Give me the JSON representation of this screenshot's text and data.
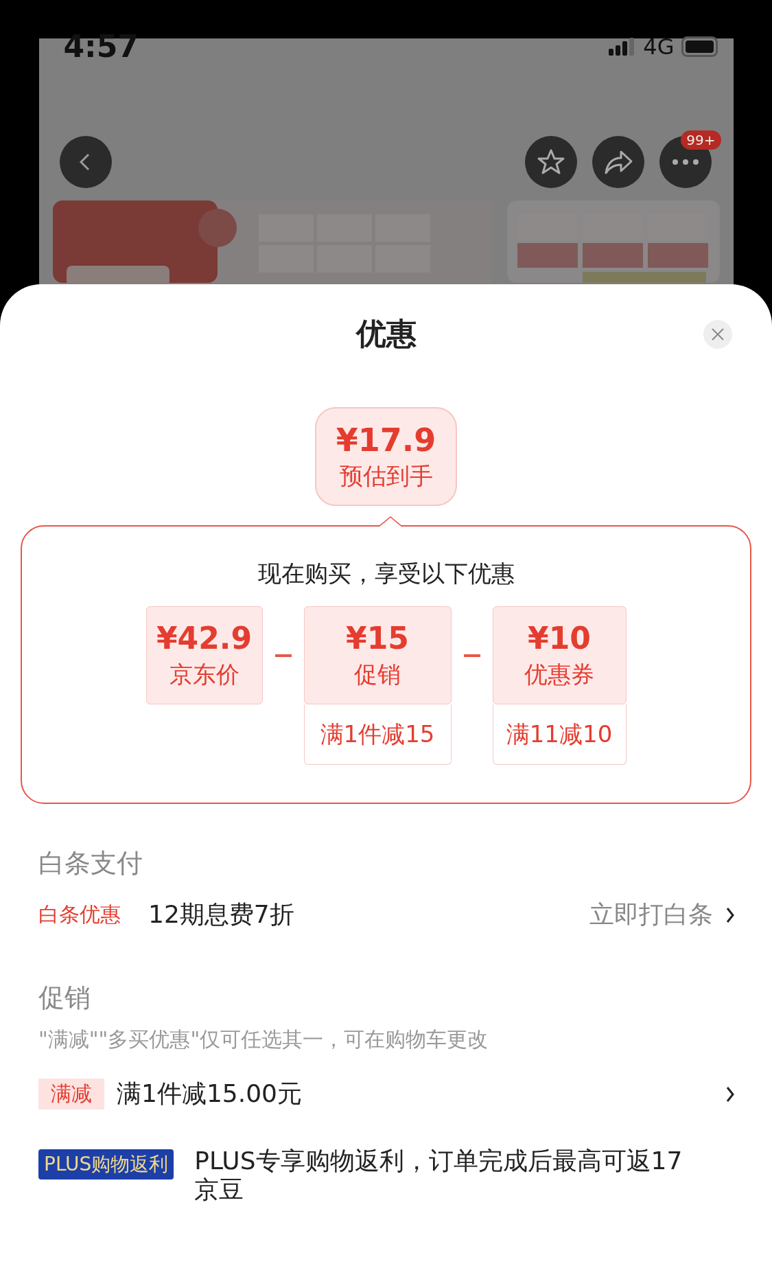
{
  "status_bar": {
    "time": "4:57",
    "network": "4G"
  },
  "nav": {
    "badge": "99+"
  },
  "sheet": {
    "title": "优惠"
  },
  "estimate": {
    "price": "¥17.9",
    "label": "预估到手"
  },
  "breakdown": {
    "heading": "现在购买，享受以下优惠",
    "items": [
      {
        "price": "¥42.9",
        "label": "京东价"
      },
      {
        "price": "¥15",
        "label": "促销",
        "condition": "满1件减15"
      },
      {
        "price": "¥10",
        "label": "优惠券",
        "condition": "满11减10"
      }
    ]
  },
  "baitiao": {
    "heading": "白条支付",
    "tag": "白条优惠",
    "text": "12期息费7折",
    "action": "立即打白条"
  },
  "promotions": {
    "heading": "促销",
    "note": "\"满减\"\"多买优惠\"仅可任选其一，可在购物车更改",
    "items": [
      {
        "kind": "full_reduction",
        "tag": "满减",
        "text": "满1件减15.00元"
      },
      {
        "kind": "plus",
        "tag": "PLUS购物返利",
        "text": "PLUS专享购物返利，订单完成后最高可返17京豆"
      }
    ]
  }
}
